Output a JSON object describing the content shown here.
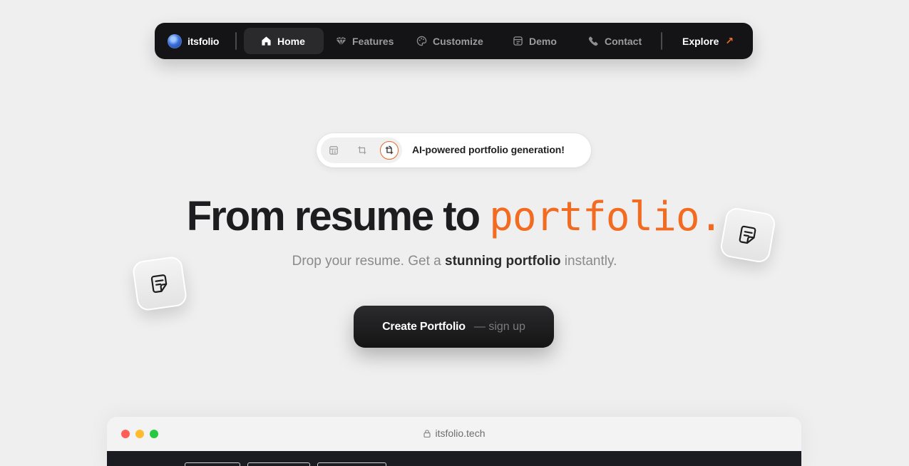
{
  "nav": {
    "brand": "itsfolio",
    "items": [
      {
        "label": "Home",
        "icon": "home-icon",
        "active": true
      },
      {
        "label": "Features",
        "icon": "gem-icon"
      },
      {
        "label": "Customize",
        "icon": "palette-icon"
      },
      {
        "label": "Demo",
        "icon": "layout-icon"
      },
      {
        "label": "Contact",
        "icon": "phone-icon"
      }
    ],
    "explore": "Explore",
    "explore_arrow": "↗"
  },
  "badge": {
    "text": "AI-powered portfolio generation!",
    "icons": [
      "template-icon",
      "crop-icon",
      "crop-rotate-icon"
    ]
  },
  "hero": {
    "headline_pre": "From resume to ",
    "headline_accent": "portfolio.",
    "sub_pre": "Drop your resume. Get a ",
    "sub_bold": "stunning portfolio",
    "sub_post": " instantly."
  },
  "cta": {
    "label": "Create Portfolio",
    "sub": "— sign up"
  },
  "preview": {
    "url": "itsfolio.tech",
    "dots": [
      "#ff5f57",
      "#febc2e",
      "#28c840"
    ]
  },
  "colors": {
    "accent": "#f26b21",
    "nav_bg": "#141416",
    "page_bg": "#efefef"
  }
}
